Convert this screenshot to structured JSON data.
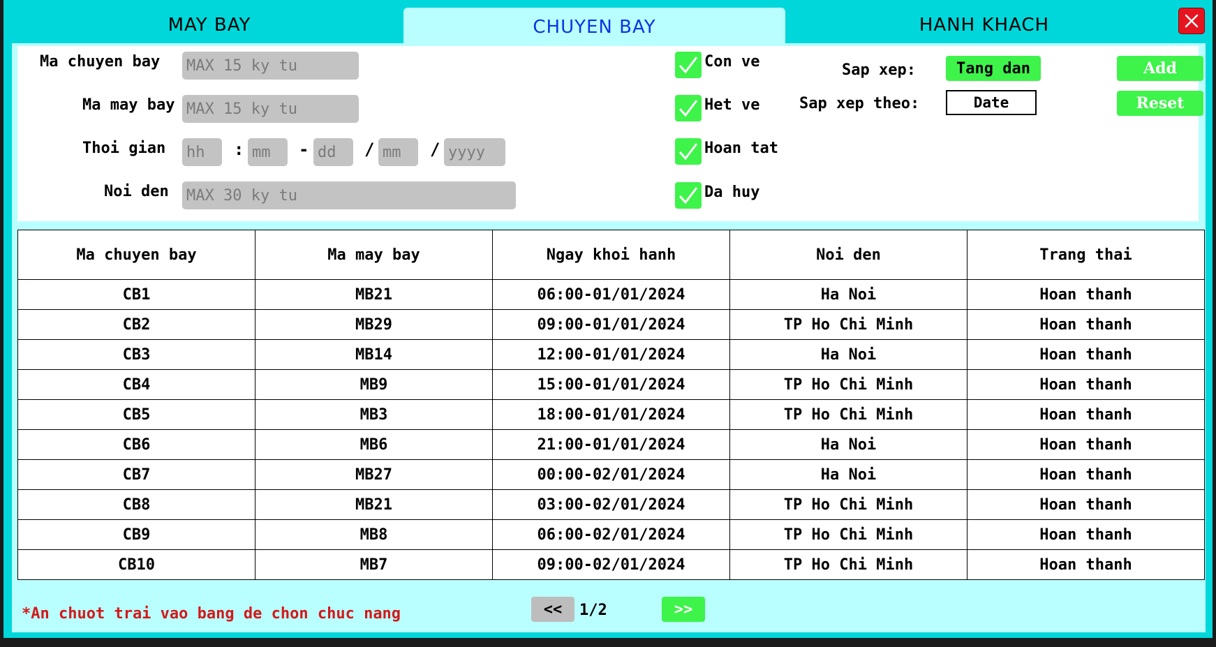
{
  "tabs": {
    "may_bay": "MAY BAY",
    "chuyen_bay": "CHUYEN BAY",
    "hanh_khach": "HANH KHACH"
  },
  "filters": {
    "ma_chuyen_bay": {
      "label": "Ma chuyen bay",
      "placeholder": "MAX 15 ky tu"
    },
    "ma_may_bay": {
      "label": "Ma may bay",
      "placeholder": "MAX 15 ky tu"
    },
    "thoi_gian": {
      "label": "Thoi gian",
      "hh": "hh",
      "mm": "mm",
      "dd": "dd",
      "month": "mm",
      "yyyy": "yyyy",
      "sep_colon": ":",
      "sep_dash": "-",
      "sep_slash": "/"
    },
    "noi_den": {
      "label": "Noi den",
      "placeholder": "MAX 30 ky tu"
    }
  },
  "status_checks": [
    {
      "label": "Con ve",
      "checked": true
    },
    {
      "label": "Het ve",
      "checked": true
    },
    {
      "label": "Hoan tat",
      "checked": true
    },
    {
      "label": "Da huy",
      "checked": true
    }
  ],
  "sort": {
    "order_label": "Sap xep:",
    "order_value": "Tang dan",
    "by_label": "Sap xep theo:",
    "by_value": "Date"
  },
  "actions": {
    "add": "Add",
    "reset": "Reset"
  },
  "table": {
    "headers": [
      "Ma chuyen bay",
      "Ma may bay",
      "Ngay khoi hanh",
      "Noi den",
      "Trang thai"
    ],
    "rows": [
      [
        "CB1",
        "MB21",
        "06:00-01/01/2024",
        "Ha Noi",
        "Hoan thanh"
      ],
      [
        "CB2",
        "MB29",
        "09:00-01/01/2024",
        "TP Ho Chi Minh",
        "Hoan thanh"
      ],
      [
        "CB3",
        "MB14",
        "12:00-01/01/2024",
        "Ha Noi",
        "Hoan thanh"
      ],
      [
        "CB4",
        "MB9",
        "15:00-01/01/2024",
        "TP Ho Chi Minh",
        "Hoan thanh"
      ],
      [
        "CB5",
        "MB3",
        "18:00-01/01/2024",
        "TP Ho Chi Minh",
        "Hoan thanh"
      ],
      [
        "CB6",
        "MB6",
        "21:00-01/01/2024",
        "Ha Noi",
        "Hoan thanh"
      ],
      [
        "CB7",
        "MB27",
        "00:00-02/01/2024",
        "Ha Noi",
        "Hoan thanh"
      ],
      [
        "CB8",
        "MB21",
        "03:00-02/01/2024",
        "TP Ho Chi Minh",
        "Hoan thanh"
      ],
      [
        "CB9",
        "MB8",
        "06:00-02/01/2024",
        "TP Ho Chi Minh",
        "Hoan thanh"
      ],
      [
        "CB10",
        "MB7",
        "09:00-02/01/2024",
        "TP Ho Chi Minh",
        "Hoan thanh"
      ]
    ]
  },
  "footer": {
    "hint": "*An chuot trai vao bang de chon chuc nang",
    "prev": "<<",
    "page": "1/2",
    "next": ">>"
  },
  "colors": {
    "background": "#00d7da",
    "panel": "#baffff",
    "active_tab_text": "#0b33e6",
    "accent_green": "#3ef34a",
    "close_red": "#e5141e",
    "hint_red": "#d41919",
    "input_gray": "#c3c3c3"
  },
  "icons": {
    "close": "close-icon",
    "check": "check-icon"
  }
}
